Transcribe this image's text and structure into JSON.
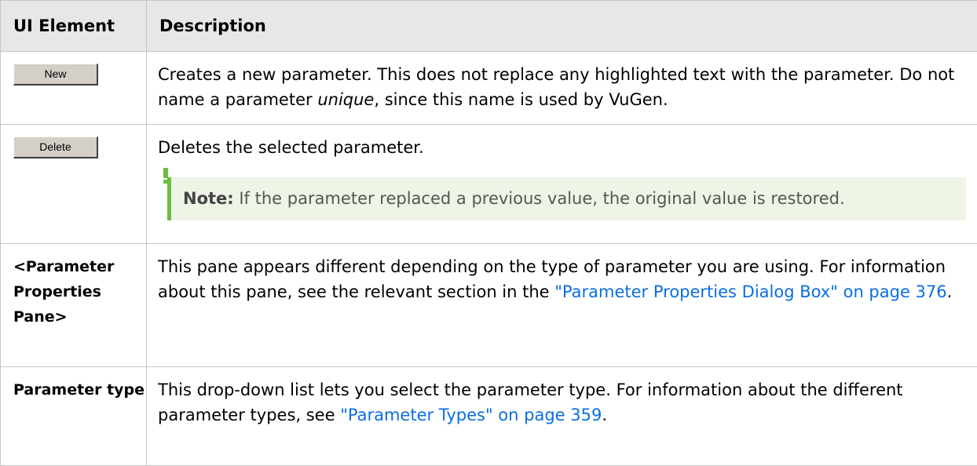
{
  "header": {
    "col_element": "UI Element",
    "col_description": "Description"
  },
  "rows": {
    "new": {
      "button_label": "New",
      "desc_1": "Creates a new parameter. This does not replace any highlighted text with the parameter. Do not name a parameter ",
      "desc_em": "unique",
      "desc_2": ", since this name is used by VuGen."
    },
    "delete": {
      "button_label": "Delete",
      "desc": "Deletes the selected parameter.",
      "note_label": "Note:",
      "note_text": " If the parameter replaced a previous value, the original value is restored."
    },
    "props": {
      "element": "<Parameter Properties Pane>",
      "desc_1": "This pane appears different depending on the type of parameter you are using. For information about this pane, see the relevant section in the ",
      "link": "\"Parameter Properties Dialog Box\" on page 376",
      "desc_2": "."
    },
    "type": {
      "element": "Parameter type",
      "desc_1": "This drop-down list lets you select the parameter type. For information about the different parameter types, see ",
      "link": "\"Parameter Types\" on page 359",
      "desc_2": "."
    }
  },
  "colors": {
    "link": "#0a6ee0",
    "note_bar": "#6abf40",
    "note_bg": "#eef4e6",
    "header_bg": "#e7e7e7"
  },
  "icons": {
    "note": "exclamation-icon"
  }
}
